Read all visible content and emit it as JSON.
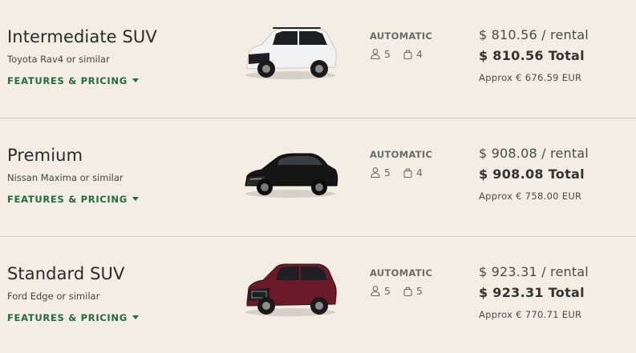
{
  "vehicles": [
    {
      "class_name": "Intermediate SUV",
      "model": "Toyota Rav4 or similar",
      "features_link": "FEATURES & PRICING",
      "transmission": "AUTOMATIC",
      "passengers": "5",
      "bags": "4",
      "price_rental": "$ 810.56 / rental",
      "price_total": "$ 810.56 Total",
      "price_approx": "Approx € 676.59 EUR",
      "car_color": "#f2f2f2",
      "car_shade": "#c9c9c9",
      "car_icon": "white-suv-image"
    },
    {
      "class_name": "Premium",
      "model": "Nissan Maxima or similar",
      "features_link": "FEATURES & PRICING",
      "transmission": "AUTOMATIC",
      "passengers": "5",
      "bags": "4",
      "price_rental": "$ 908.08 / rental",
      "price_total": "$ 908.08 Total",
      "price_approx": "Approx € 758.00 EUR",
      "car_color": "#151515",
      "car_shade": "#000000",
      "car_icon": "black-sedan-image"
    },
    {
      "class_name": "Standard SUV",
      "model": "Ford Edge or similar",
      "features_link": "FEATURES & PRICING",
      "transmission": "AUTOMATIC",
      "passengers": "5",
      "bags": "5",
      "price_rental": "$ 923.31 / rental",
      "price_total": "$ 923.31 Total",
      "price_approx": "Approx € 770.71 EUR",
      "car_color": "#6b1a2a",
      "car_shade": "#3d0c17",
      "car_icon": "maroon-suv-image"
    }
  ],
  "theme": {
    "background": "#f4ede4",
    "accent_green": "#1f6d3b",
    "divider": "#d6cec4"
  }
}
